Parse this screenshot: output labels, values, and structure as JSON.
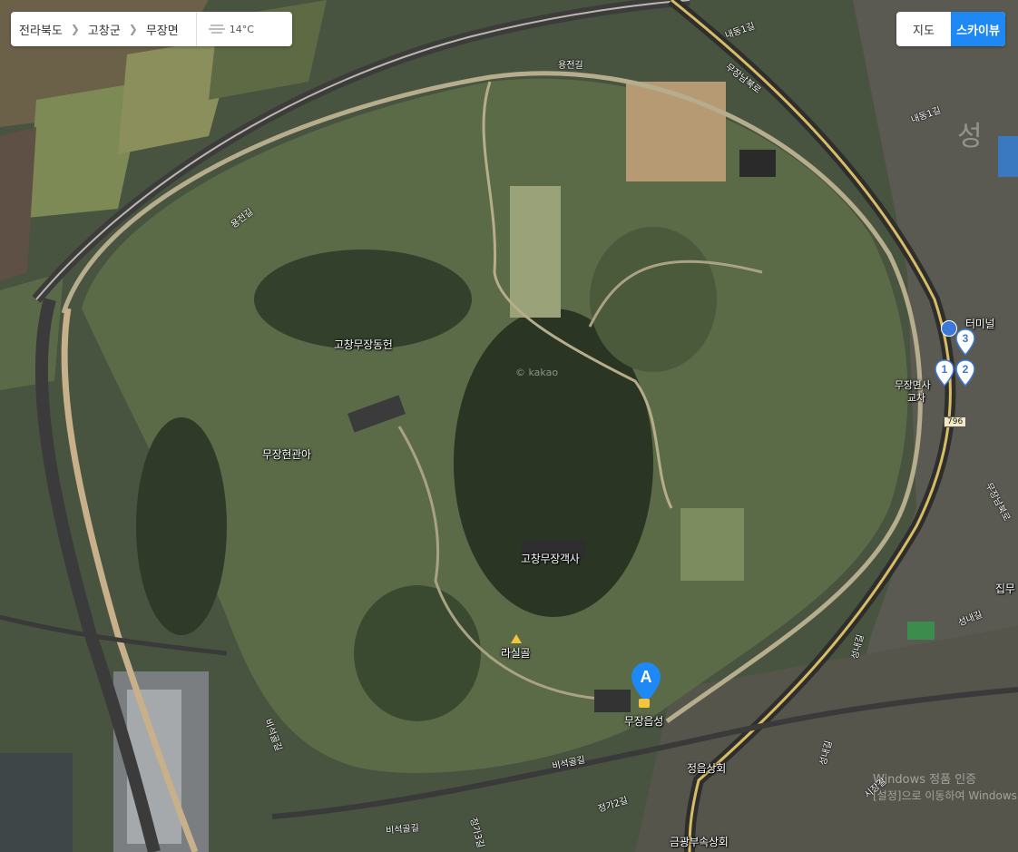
{
  "breadcrumb": {
    "province": "전라북도",
    "county": "고창군",
    "town": "무장면"
  },
  "weather": {
    "icon": "fog-icon",
    "temperature": "14°C"
  },
  "view_toggle": {
    "map_label": "지도",
    "skyview_label": "스카이뷰",
    "active": "skyview"
  },
  "places": {
    "dongheon": "고창무장동헌",
    "gwana": "무장현관아",
    "gaeksa": "고창무장객사",
    "rasilgol": "라실골",
    "eupseong": "무장읍성",
    "jeongeup_store": "정읍상회",
    "geumgwang_store": "금광부속상회",
    "terminal": "터미널",
    "office_partial": "무장면사",
    "intersection_partial": "교차",
    "seongbuk_partial": "성",
    "right_partial": "집무"
  },
  "roads": {
    "yongjeon": "용전길",
    "yongjeon2": "용전길",
    "naedong": "내동1길",
    "naedong2": "내동1길",
    "mujang_north": "무장남북로",
    "mujang_side": "무장남북로",
    "seongnae": "성내길",
    "seongnae2": "성내길",
    "seongnae3": "성내길",
    "biseok": "비석골길",
    "biseok2": "비석골길",
    "biseok3": "비석골길",
    "jeongga": "정가2길",
    "jeongga2": "정가3길",
    "sigjang": "시장길",
    "route_shield": "796"
  },
  "markers": {
    "a_label": "A",
    "pin1": "1",
    "pin2": "2",
    "pin3": "3"
  },
  "watermarks": {
    "kakao": "© kakao",
    "windows_line1": "Windows 정품 인증",
    "windows_line2": "[설정]으로 이동하여 Windows"
  }
}
